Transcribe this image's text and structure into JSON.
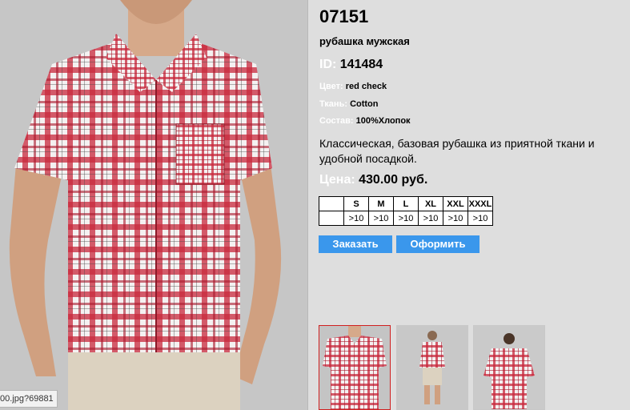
{
  "product": {
    "code": "07151",
    "name": "рубашка мужская",
    "id_label": "ID:",
    "id_value": "141484",
    "color_label": "Цвет:",
    "color_value": "red check",
    "fabric_label": "Ткань:",
    "fabric_value": "Cotton",
    "composition_label": "Состав:",
    "composition_value": "100%Хлопок",
    "description": "Классическая, базовая рубашка из приятной ткани и удобной посадкой.",
    "price_label": "Цена:",
    "price_value": "430.00 руб."
  },
  "sizes": {
    "headers": [
      "S",
      "M",
      "L",
      "XL",
      "XXL",
      "XXXL"
    ],
    "stock": [
      ">10",
      ">10",
      ">10",
      ">10",
      ">10",
      ">10"
    ]
  },
  "buttons": {
    "order": "Заказать",
    "checkout": "Оформить"
  },
  "status_bar": {
    "url": "00.jpg?69881"
  },
  "colors": {
    "accent": "#3a97ec",
    "shirt_red": "#c8283c",
    "background": "#dcdcdc"
  }
}
